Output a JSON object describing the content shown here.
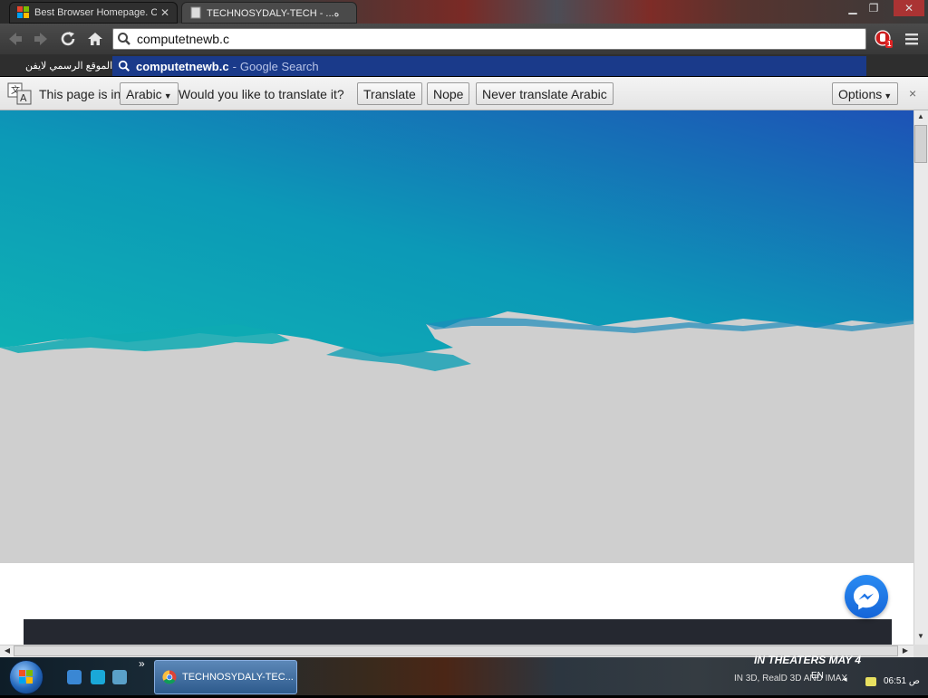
{
  "tabs": [
    {
      "title": "Best Browser Homepage. Cu",
      "active": false,
      "favicon": "windows-logo-icon"
    },
    {
      "title": "TECHNOSYDALY-TECH - ...ه",
      "active": true,
      "favicon": "page-icon"
    }
  ],
  "window_controls": {
    "minimize": "▁",
    "restore": "❐",
    "close": "✕"
  },
  "toolbar": {
    "back_icon": "back-arrow-icon",
    "forward_icon": "forward-arrow-icon",
    "reload_icon": "reload-icon",
    "home_icon": "home-icon",
    "address_value": "computetnewb.c",
    "extension_badge": "1"
  },
  "bookmarks": [
    {
      "label": "... الموقع الرسمي لايفن"
    }
  ],
  "suggestion": {
    "query": "computetnewb.c",
    "separator": "-",
    "source": "Google Search"
  },
  "translate_bar": {
    "prefix": "This page is in",
    "language": "Arabic",
    "question": "Would you like to translate it?",
    "translate_label": "Translate",
    "nope_label": "Nope",
    "never_label": "Never translate Arabic",
    "options_label": "Options",
    "close": "×"
  },
  "taskbar": {
    "overflow": "»",
    "task_label": "TECHNOSYDALY-TEC...",
    "banner_line1": "IN THEATERS MAY 4",
    "banner_line2": "IN 3D, RealD 3D AND IMAX",
    "lang": "EN",
    "clock": "06:51 ص"
  },
  "colors": {
    "hero_teal": "#0ea3b0",
    "hero_blue": "#1d5fb8",
    "page_gray": "#cfcfcf",
    "dark_strip": "#252830",
    "suggest_bg": "#1a3a8a"
  }
}
